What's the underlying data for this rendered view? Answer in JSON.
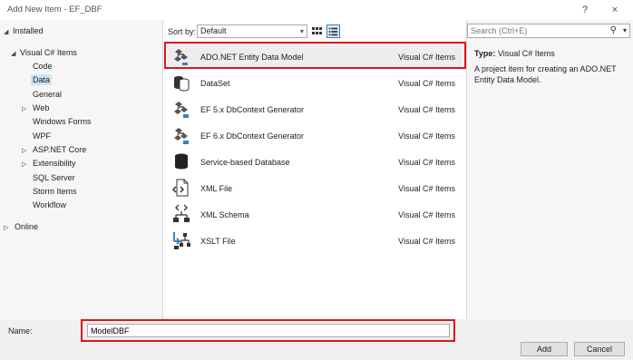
{
  "window": {
    "title": "Add New Item - EF_DBF",
    "help_glyph": "?",
    "close_glyph": "×"
  },
  "tree": {
    "installed": "Installed",
    "visual_csharp": "Visual C# Items",
    "children": [
      "Code",
      "Data",
      "General",
      "Web",
      "Windows Forms",
      "WPF",
      "ASP.NET Core",
      "Extensibility",
      "SQL Server",
      "Storm Items",
      "Workflow"
    ],
    "selected": "Data",
    "online": "Online"
  },
  "toolbar": {
    "sort_label": "Sort by:",
    "sort_value": "Default"
  },
  "items": [
    {
      "name": "ADO.NET Entity Data Model",
      "category": "Visual C# Items",
      "icon": "entity-model-icon"
    },
    {
      "name": "DataSet",
      "category": "Visual C# Items",
      "icon": "dataset-icon"
    },
    {
      "name": "EF 5.x DbContext Generator",
      "category": "Visual C# Items",
      "icon": "ef-generator-icon"
    },
    {
      "name": "EF 6.x DbContext Generator",
      "category": "Visual C# Items",
      "icon": "ef-generator-icon"
    },
    {
      "name": "Service-based Database",
      "category": "Visual C# Items",
      "icon": "database-icon"
    },
    {
      "name": "XML File",
      "category": "Visual C# Items",
      "icon": "xml-file-icon"
    },
    {
      "name": "XML Schema",
      "category": "Visual C# Items",
      "icon": "xml-schema-icon"
    },
    {
      "name": "XSLT File",
      "category": "Visual C# Items",
      "icon": "xslt-file-icon"
    }
  ],
  "details": {
    "search_placeholder": "Search (Ctrl+E)",
    "type_label": "Type:",
    "type_value": "Visual C# Items",
    "description": "A project item for creating an ADO.NET Entity Data Model."
  },
  "footer": {
    "name_label": "Name:",
    "name_value": "ModelDBF",
    "add_label": "Add",
    "cancel_label": "Cancel"
  },
  "colors": {
    "highlight_box": "#e0131b",
    "selection": "#cce4f7"
  }
}
